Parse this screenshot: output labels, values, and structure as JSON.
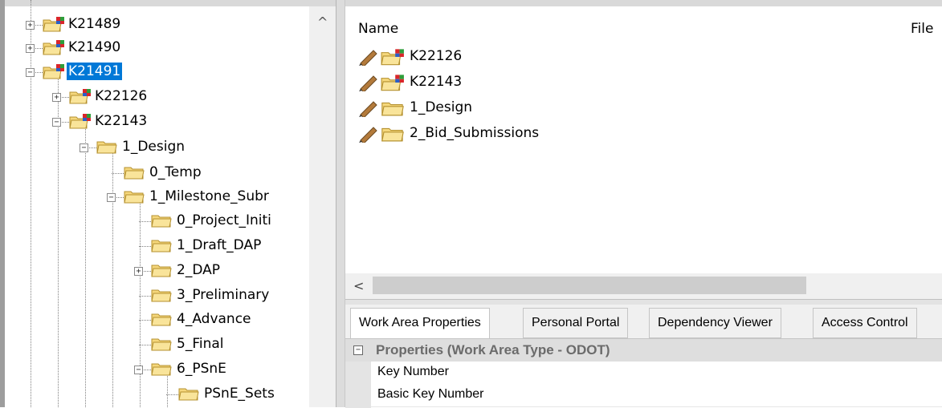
{
  "tree": {
    "nodes": [
      {
        "label": "K21489"
      },
      {
        "label": "K21490"
      },
      {
        "label": "K21491"
      },
      {
        "label": "K22126"
      },
      {
        "label": "K22143"
      },
      {
        "label": "1_Design"
      },
      {
        "label": "0_Temp"
      },
      {
        "label": "1_Milestone_Subr"
      },
      {
        "label": "0_Project_Initi"
      },
      {
        "label": "1_Draft_DAP"
      },
      {
        "label": "2_DAP"
      },
      {
        "label": "3_Preliminary"
      },
      {
        "label": "4_Advance"
      },
      {
        "label": "5_Final"
      },
      {
        "label": "6_PSnE"
      },
      {
        "label": "PSnE_Sets"
      }
    ],
    "scroll_up_icon": "^"
  },
  "list": {
    "columns": {
      "name": "Name",
      "file": "File"
    },
    "items": [
      {
        "label": "K22126"
      },
      {
        "label": "K22143"
      },
      {
        "label": "1_Design"
      },
      {
        "label": "2_Bid_Submissions"
      }
    ],
    "scroll_left_icon": "<"
  },
  "tabs": [
    {
      "label": "Work Area Properties"
    },
    {
      "label": "Personal Portal"
    },
    {
      "label": "Dependency Viewer"
    },
    {
      "label": "Access Control"
    }
  ],
  "properties": {
    "category": "Properties (Work Area Type - ODOT)",
    "rows": [
      {
        "label": "Key Number"
      },
      {
        "label": "Basic Key Number"
      }
    ]
  },
  "colors": {
    "selection": "#0078d7",
    "folder": "#f5d77c",
    "workarea_badge_red": "#d9262a",
    "workarea_badge_green": "#2e9e3a",
    "workarea_badge_blue": "#2a5fc8",
    "pencil": "#b37a3b"
  }
}
